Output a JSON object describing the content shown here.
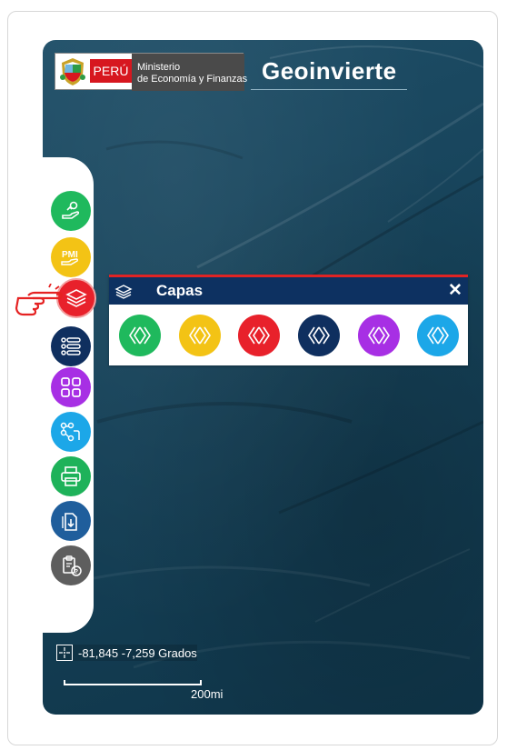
{
  "header": {
    "country": "PERÚ",
    "ministry_line1": "Ministerio",
    "ministry_line2": "de Economía y Finanzas",
    "app_name": "Geoinvierte"
  },
  "sidebar": {
    "tools": [
      {
        "name": "investment-hand-icon",
        "color": "#1fb95d"
      },
      {
        "name": "pmi-icon",
        "color": "#f3c315"
      },
      {
        "name": "layers-icon",
        "color": "#e8212b",
        "active": true
      },
      {
        "name": "list-icon",
        "color": "#0f2f5f"
      },
      {
        "name": "grid-icon",
        "color": "#a72fe4"
      },
      {
        "name": "network-icon",
        "color": "#1ca7e8"
      },
      {
        "name": "printer-icon",
        "color": "#1eb25a"
      },
      {
        "name": "download-doc-icon",
        "color": "#1f5e9c"
      },
      {
        "name": "help-doc-icon",
        "color": "#5e5e5e"
      }
    ]
  },
  "panel": {
    "title": "Capas",
    "close_label": "✕",
    "layers": [
      {
        "color": "#1fb95d"
      },
      {
        "color": "#f3c315"
      },
      {
        "color": "#e8212b"
      },
      {
        "color": "#0f2f5f"
      },
      {
        "color": "#a72fe4"
      },
      {
        "color": "#1ca7e8"
      }
    ]
  },
  "status": {
    "coordinates": "-81,845 -7,259 Grados",
    "scale": "200mi"
  }
}
